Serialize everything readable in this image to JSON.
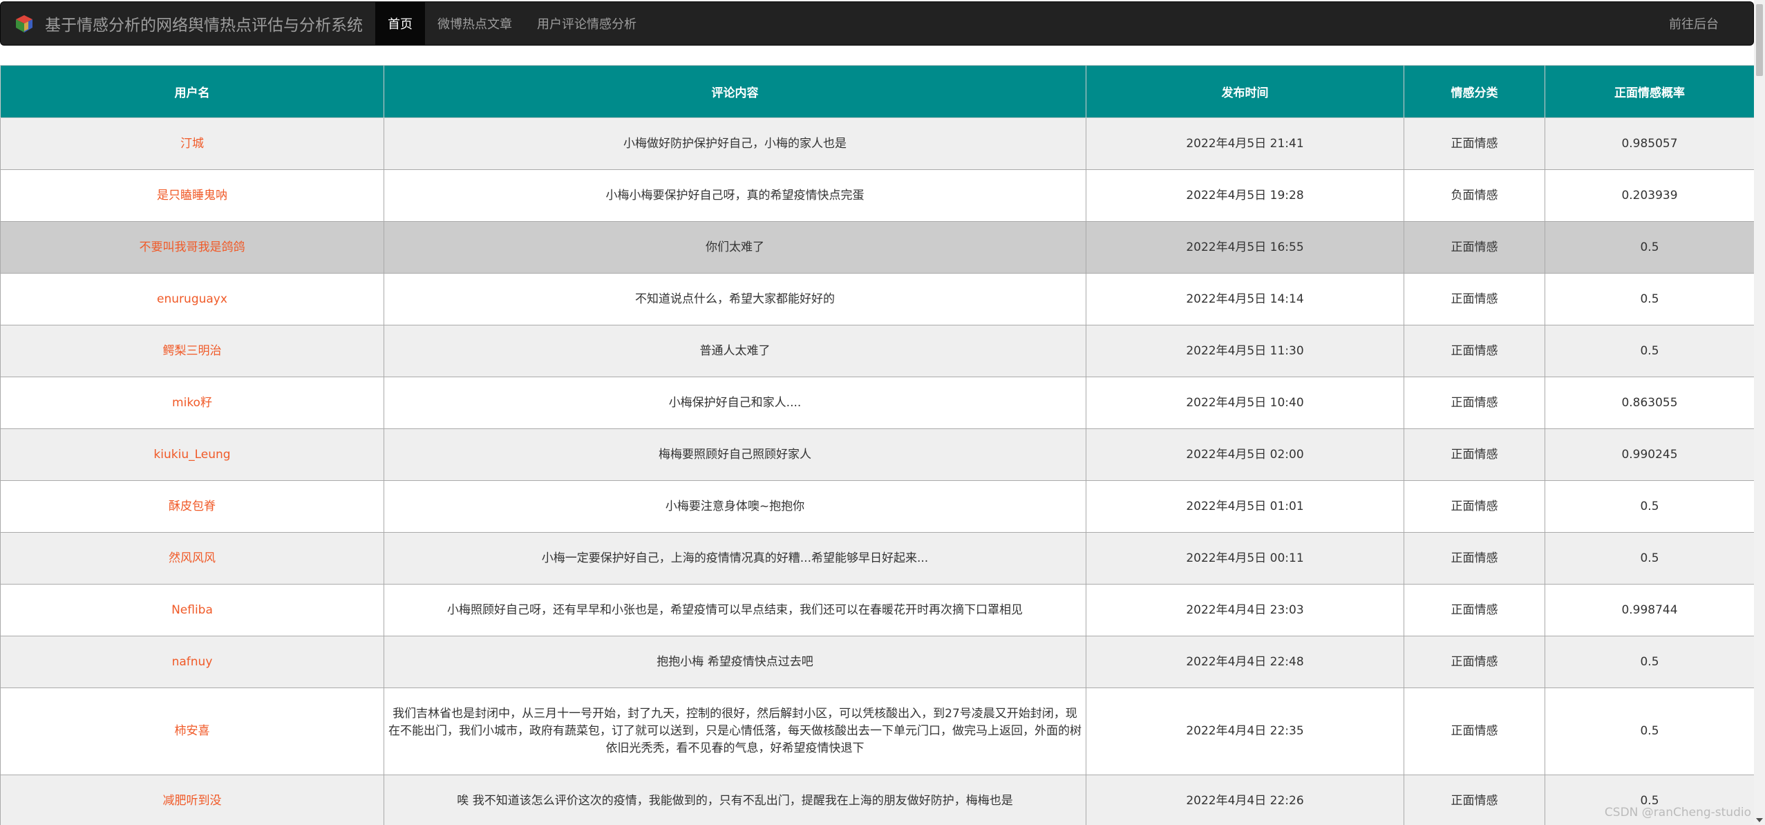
{
  "navbar": {
    "title": "基于情感分析的网络舆情热点评估与分析系统",
    "logo_icon": "cube-logo-icon",
    "items": [
      {
        "label": "首页",
        "active": true
      },
      {
        "label": "微博热点文章",
        "active": false
      },
      {
        "label": "用户评论情感分析",
        "active": false
      }
    ],
    "right_link": "前往后台"
  },
  "table": {
    "headers": [
      "用户名",
      "评论内容",
      "发布时间",
      "情感分类",
      "正面情感概率"
    ],
    "rows": [
      {
        "user": "汀城",
        "content": "小梅做好防护保护好自己，小梅的家人也是",
        "time": "2022年4月5日 21:41",
        "sentiment": "正面情感",
        "prob": "0.985057"
      },
      {
        "user": "是只瞌睡鬼呐",
        "content": "小梅小梅要保护好自己呀，真的希望疫情快点完蛋",
        "time": "2022年4月5日 19:28",
        "sentiment": "负面情感",
        "prob": "0.203939"
      },
      {
        "user": "不要叫我哥我是鸽鸽",
        "content": "你们太难了",
        "time": "2022年4月5日 16:55",
        "sentiment": "正面情感",
        "prob": "0.5"
      },
      {
        "user": "enuruguayx",
        "content": "不知道说点什么，希望大家都能好好的",
        "time": "2022年4月5日 14:14",
        "sentiment": "正面情感",
        "prob": "0.5"
      },
      {
        "user": "鳄梨三明治",
        "content": "普通人太难了",
        "time": "2022年4月5日 11:30",
        "sentiment": "正面情感",
        "prob": "0.5"
      },
      {
        "user": "miko籽",
        "content": "小梅保护好自己和家人....",
        "time": "2022年4月5日 10:40",
        "sentiment": "正面情感",
        "prob": "0.863055"
      },
      {
        "user": "kiukiu_Leung",
        "content": "梅梅要照顾好自己照顾好家人",
        "time": "2022年4月5日 02:00",
        "sentiment": "正面情感",
        "prob": "0.990245"
      },
      {
        "user": "酥皮包脊",
        "content": "小梅要注意身体噢~抱抱你",
        "time": "2022年4月5日 01:01",
        "sentiment": "正面情感",
        "prob": "0.5"
      },
      {
        "user": "然风风风",
        "content": "小梅一定要保护好自己，上海的疫情情况真的好糟...希望能够早日好起来...",
        "time": "2022年4月5日 00:11",
        "sentiment": "正面情感",
        "prob": "0.5"
      },
      {
        "user": "Nefliba",
        "content": "小梅照顾好自己呀，还有早早和小张也是，希望疫情可以早点结束，我们还可以在春暖花开时再次摘下口罩相见",
        "time": "2022年4月4日 23:03",
        "sentiment": "正面情感",
        "prob": "0.998744"
      },
      {
        "user": "nafnuy",
        "content": "抱抱小梅 希望疫情快点过去吧",
        "time": "2022年4月4日 22:48",
        "sentiment": "正面情感",
        "prob": "0.5"
      },
      {
        "user": "柿安喜",
        "content": "我们吉林省也是封闭中，从三月十一号开始，封了九天，控制的很好，然后解封小区，可以凭核酸出入，到27号凌晨又开始封闭，现在不能出门，我们小城市，政府有蔬菜包，订了就可以送到，只是心情低落，每天做核酸出去一下单元门口，做完马上返回，外面的树依旧光秃秃，看不见春的气息，好希望疫情快退下",
        "time": "2022年4月4日 22:35",
        "sentiment": "正面情感",
        "prob": "0.5"
      },
      {
        "user": "减肥听到没",
        "content": "唉 我不知道该怎么评价这次的疫情，我能做到的，只有不乱出门，提醒我在上海的朋友做好防护，梅梅也是",
        "time": "2022年4月4日 22:26",
        "sentiment": "正面情感",
        "prob": "0.5"
      }
    ]
  },
  "watermark": "CSDN @ranCheng-studio"
}
